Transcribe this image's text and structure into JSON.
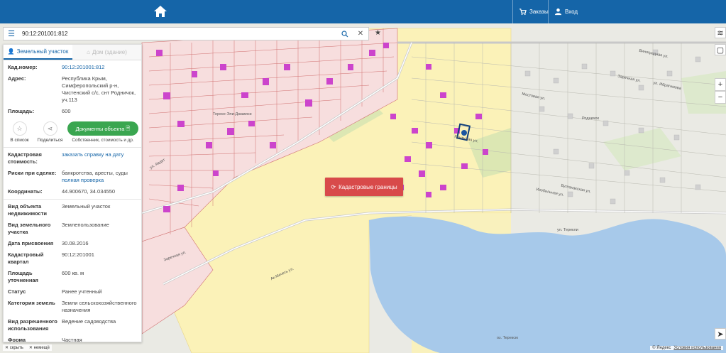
{
  "header": {
    "orders_label": "Заказы",
    "login_label": "Вход"
  },
  "search": {
    "query": "90:12:201001:812"
  },
  "panel": {
    "tabs": [
      {
        "label": "Земельный участок"
      },
      {
        "label": "Дом (здание)"
      }
    ],
    "top_fields": [
      {
        "key": "Кад.номер:",
        "value": "90:12:201001:812",
        "link": true
      },
      {
        "key": "Адрес:",
        "value": "Республика Крым, Симферопольский р-н, Чистенский с/с, снт Родничок, уч.113",
        "link": false
      },
      {
        "key": "Площадь:",
        "value": "600",
        "link": false
      }
    ],
    "actions": {
      "to_list": "В список",
      "share": "Поделиться",
      "documents": "Документы объекта",
      "documents_sub": "Собственник, стоимость и др."
    },
    "mid_fields": [
      {
        "key": "Кадастровая стоимость:",
        "value": "заказать справку на дату",
        "link": true
      },
      {
        "key": "Риски при сделке:",
        "value": "банкротства, аресты, суды",
        "value2": "полная проверка",
        "link": false
      },
      {
        "key": "Координаты:",
        "value": "44.900670, 34.034550",
        "link": false
      }
    ],
    "bottom_fields": [
      {
        "key": "Вид объекта недвижимости",
        "value": "Земельный участок"
      },
      {
        "key": "Вид земельного участка",
        "value": "Землепользование"
      },
      {
        "key": "Дата присвоения",
        "value": "30.08.2016"
      },
      {
        "key": "Кадастровый квартал",
        "value": "90:12:201001"
      },
      {
        "key": "Площадь уточненная",
        "value": "600 кв. м"
      },
      {
        "key": "Статус",
        "value": "Ранее учтенный"
      },
      {
        "key": "Категория земель",
        "value": "Земли сельскохозяйственного назначения"
      },
      {
        "key": "Вид разрешенного использования",
        "value": "Ведение садоводства"
      },
      {
        "key": "Форма собственности",
        "value": "Частная"
      }
    ]
  },
  "map": {
    "kad_button": "Кадастровые границы",
    "labels": {
      "sadovaya": "ул. Авдет",
      "zarechnaya1": "Заречная ул.",
      "zarechnaya2": "Заречная ул.",
      "mostovaya": "Мостовая ул.",
      "bulganakskaya": "Булганакская ул.",
      "izobilnaya": "Изобильная ул.",
      "teren": "ул. Терекли",
      "lake": "оз. Терексю",
      "rodnichok": "Родничок",
      "krymskaya": "Крымская ул.",
      "vinogradnaya": "Виноградная ул.",
      "ibragimova": "ул. Ибрагимова",
      "tereke": "Тереке-Эли-Джамиси",
      "ak_meshit": "Ак-Мечеть ул."
    },
    "colors": {
      "parcel_fill": "#f7dede",
      "parcel_line": "#d07070",
      "yellow_zone": "#fbf2b8",
      "lake": "#a7c9ea",
      "building": "#cc44cc"
    }
  },
  "footer": {
    "hide": "скрыть",
    "legend": "немещё",
    "yandex": "© Яндекс",
    "terms": "Условия использования"
  }
}
